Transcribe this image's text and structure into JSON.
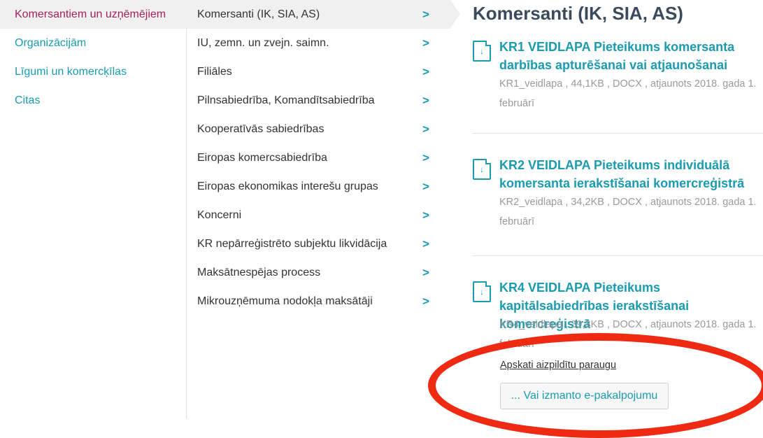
{
  "left_nav": [
    "Komersantiem un uzņēmējiem",
    "Organizācijām",
    "Līgumi un komercķīlas",
    "Citas"
  ],
  "sub_nav": [
    "Komersanti (IK, SIA, AS)",
    "IU, zemn. un zvejn. saimn.",
    "Filiāles",
    "Pilnsabiedrība, Komandītsabiedrība",
    "Kooperatīvās sabiedrības",
    "Eiropas komercsabiedrība",
    "Eiropas ekonomikas interešu grupas",
    "Koncerni",
    "KR nepārreģistrēto subjektu likvidācija",
    "Maksātnespējas process",
    "Mikrouzņēmuma nodokļa maksātāji"
  ],
  "chevron": ">",
  "content": {
    "heading": "Komersanti (IK, SIA, AS)",
    "download_glyph": "↓",
    "docs": [
      {
        "title": "KR1 VEIDLAPA Pieteikums komersanta darbības apturēšanai vai atjaunošanai",
        "meta": "KR1_veidlapa , 44,1KB , DOCX , atjaunots 2018. gada 1. februārī"
      },
      {
        "title": "KR2 VEIDLAPA Pieteikums individuālā komersanta ierakstīšanai komercreģistrā",
        "meta": "KR2_veidlapa , 34,2KB , DOCX , atjaunots 2018. gada 1. februārī"
      },
      {
        "title": "KR4 VEIDLAPA Pieteikums kapitālsabiedrības ierakstīšanai komercreģistrā",
        "meta": "KR4_veidlapa , 39,8KB , DOCX , atjaunots 2018. gada 1. februārī"
      }
    ],
    "example_link": "Apskati aizpildītu paraugu",
    "eservice_button": "... Vai izmanto e-pakalpojumu"
  },
  "colors": {
    "accent": "#1a9bb0",
    "active": "#a3205f",
    "highlight_oval": "#ee2a12"
  }
}
